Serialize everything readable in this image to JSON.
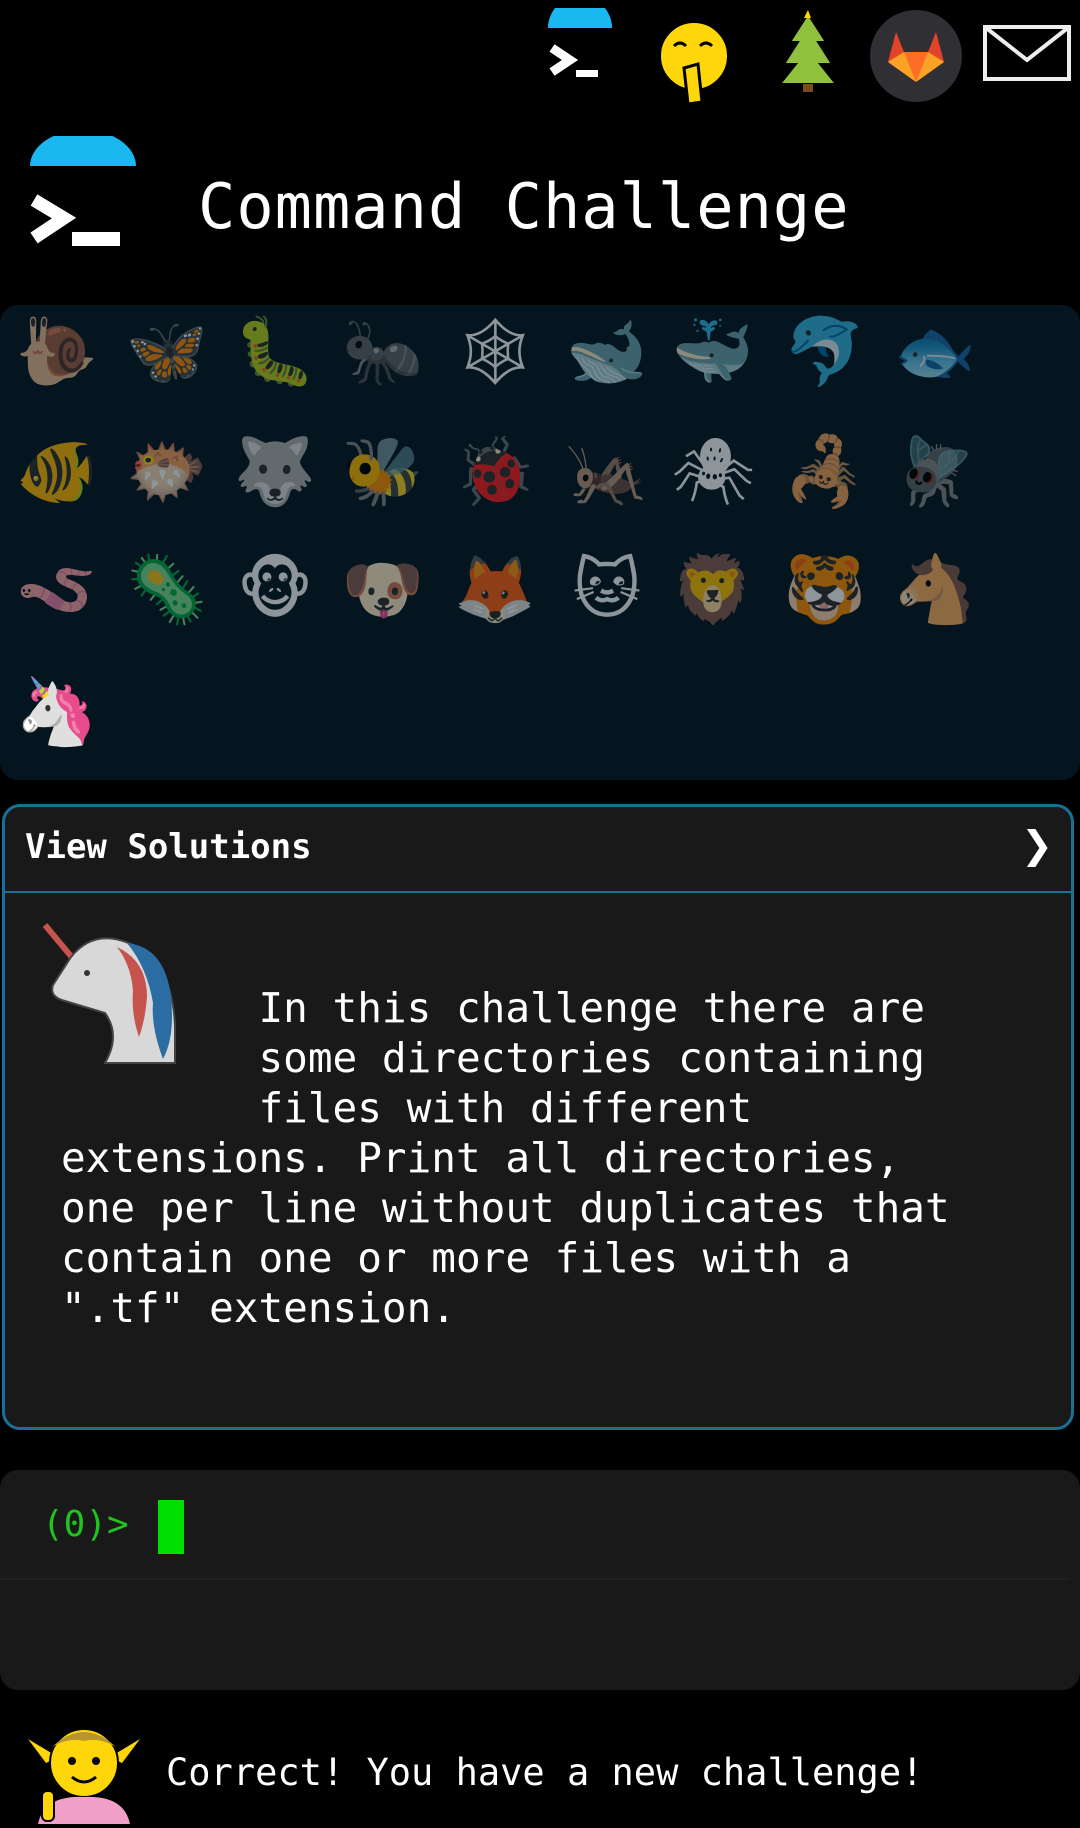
{
  "app": {
    "title": "Command Challenge"
  },
  "topbar": {
    "icons": [
      "terminal-icon",
      "shushing-face-icon",
      "christmas-tree-icon",
      "gitlab-icon",
      "envelope-icon"
    ]
  },
  "grid": {
    "rows": [
      [
        "🐌",
        "🦋",
        "🐛",
        "🐜",
        "🕸",
        "🐋",
        "🐳",
        "🐬",
        "🐟"
      ],
      [
        "🐠",
        "🐡",
        "🐺",
        "🐝",
        "🐞",
        "🦗",
        "🕷",
        "🦂",
        "🪰"
      ],
      [
        "🪱",
        "🦠",
        "🐵",
        "🐶",
        "🦊",
        "🐱",
        "🦁",
        "🐯",
        "🐴"
      ],
      [
        "🦄"
      ]
    ]
  },
  "solutions": {
    "title": "View Solutions",
    "chevron": "❯",
    "text": "        In this challenge there are\n        some directories containing\n        files with different\nextensions. Print all directories,\none per line without duplicates that\ncontain one or more files with a\n\".tf\" extension."
  },
  "terminal": {
    "prompt": "(0)>"
  },
  "status": {
    "message": "Correct! You have a new challenge!"
  },
  "colors": {
    "accent": "#1a6f96",
    "prompt": "#1fc41f",
    "cursor": "#00e000",
    "panel": "#191919",
    "grid_bg": "#04151f"
  }
}
